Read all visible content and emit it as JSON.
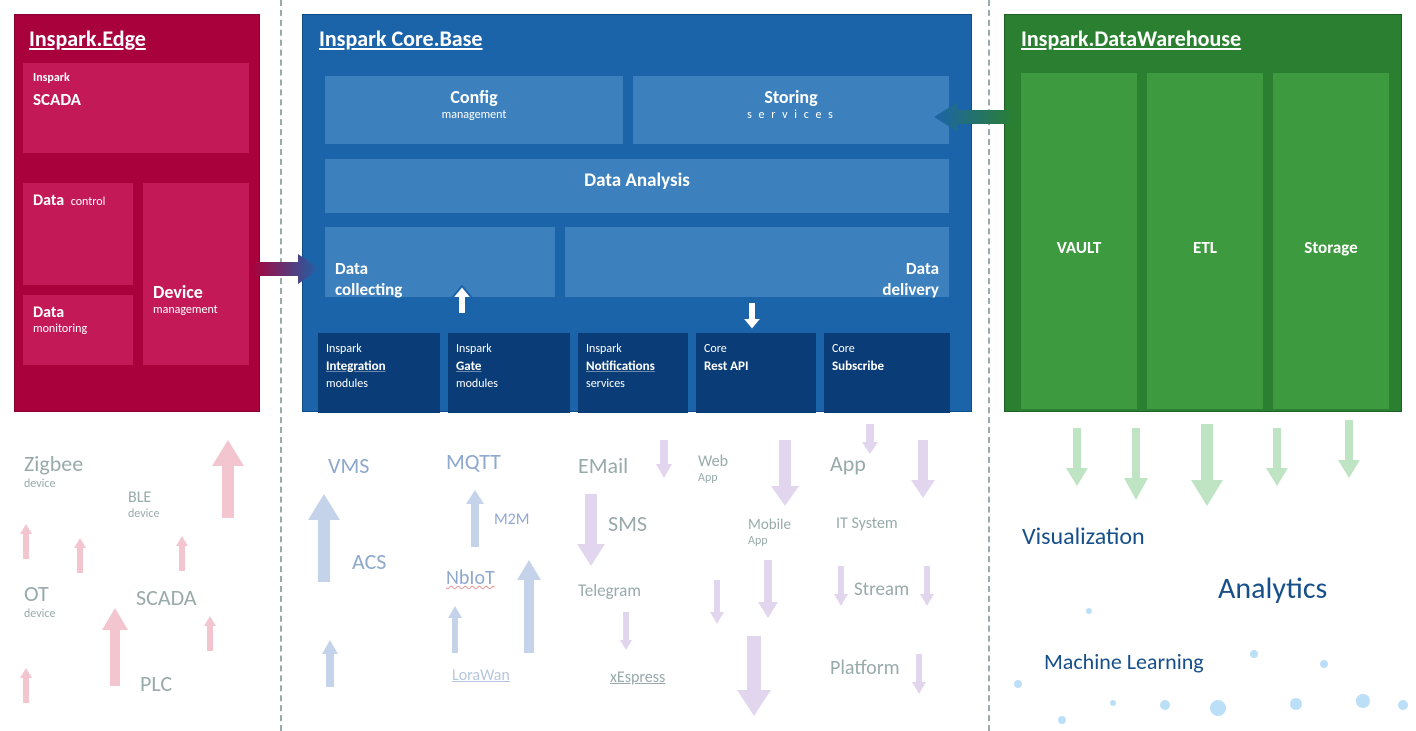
{
  "edge": {
    "title": "Inspark.Edge",
    "scada_top": "Inspark",
    "scada": "SCADA",
    "data_control": "Data",
    "data_control_sub": "control",
    "device": "Device",
    "device_sub": "management",
    "data_mon": "Data",
    "data_mon_sub": "monitoring",
    "devices": {
      "zigbee": "Zigbee",
      "zigbee_sub": "device",
      "ble": "BLE",
      "ble_sub": "device",
      "ot": "OT",
      "ot_sub": "device",
      "scada": "SCADA",
      "plc": "PLC"
    }
  },
  "core": {
    "title": "Inspark Core.Base",
    "config": "Config",
    "config_sub": "management",
    "storing": "Storing",
    "storing_sub": "s e r v i c e s",
    "analysis": "Data Analysis",
    "collect": "Data\ncollecting",
    "deliver": "Data\ndelivery",
    "modules": {
      "m1_pre": "Inspark",
      "m1": "Integration",
      "m1_sub": "modules",
      "m2_pre": "Inspark",
      "m2": "Gate",
      "m2_sub": "modules",
      "m3_pre": "Inspark",
      "m3": "Notifications",
      "m3_sub": "services",
      "m4_pre": "Core",
      "m4": "Rest API",
      "m5_pre": "Core",
      "m5": "Subscribe"
    },
    "downstream": {
      "vms": "VMS",
      "acs": "ACS",
      "mqtt": "MQTT",
      "m2m": "M2M",
      "nbiot": "NbIoT",
      "lorawan": "LoraWan",
      "email": "EMail",
      "sms": "SMS",
      "telegram": "Telegram",
      "xespress": "xEspress",
      "webapp": "Web",
      "webapp_sub": "App",
      "mobile": "Mobile",
      "mobile_sub": "App",
      "app": "App",
      "itsys": "IT System",
      "stream": "Stream",
      "platform": "Platform"
    }
  },
  "dw": {
    "title": "Inspark.DataWarehouse",
    "vault": "VAULT",
    "etl": "ETL",
    "storage": "Storage",
    "out": {
      "viz": "Visualization",
      "analytics": "Analytics",
      "ml": "Machine Learning"
    }
  }
}
